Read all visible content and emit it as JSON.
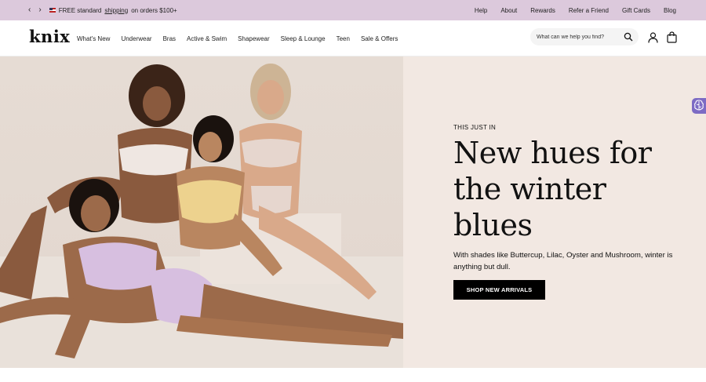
{
  "announcement": {
    "prev_icon": "chevron-left",
    "next_icon": "chevron-right",
    "prev_glyph": "‹",
    "next_glyph": "›",
    "promo_prefix": "FREE standard",
    "promo_link": "shipping",
    "promo_suffix": "on orders $100+",
    "links": [
      "Help",
      "About",
      "Rewards",
      "Refer a Friend",
      "Gift Cards",
      "Blog"
    ],
    "bg_color": "#dcc9dc"
  },
  "header": {
    "logo": "knix",
    "nav": [
      "What's New",
      "Underwear",
      "Bras",
      "Active & Swim",
      "Shapewear",
      "Sleep & Lounge",
      "Teen",
      "Sale & Offers"
    ],
    "search_placeholder": "What can we help you find?",
    "icons": [
      "search-icon",
      "account-icon",
      "bag-icon"
    ]
  },
  "hero": {
    "eyebrow": "THIS JUST IN",
    "headline": "New hues for the winter blues",
    "subcopy": "With shades like Buttercup, Lilac, Oyster and Mushroom, winter is anything but dull.",
    "cta": "SHOP NEW ARRIVALS",
    "bg_color": "#f2e8e2",
    "image": "photo of four models in lilac, buttercup and oyster bras"
  },
  "accessibility_widget": {
    "icon": "brain-icon",
    "color": "#7d6bc4"
  }
}
